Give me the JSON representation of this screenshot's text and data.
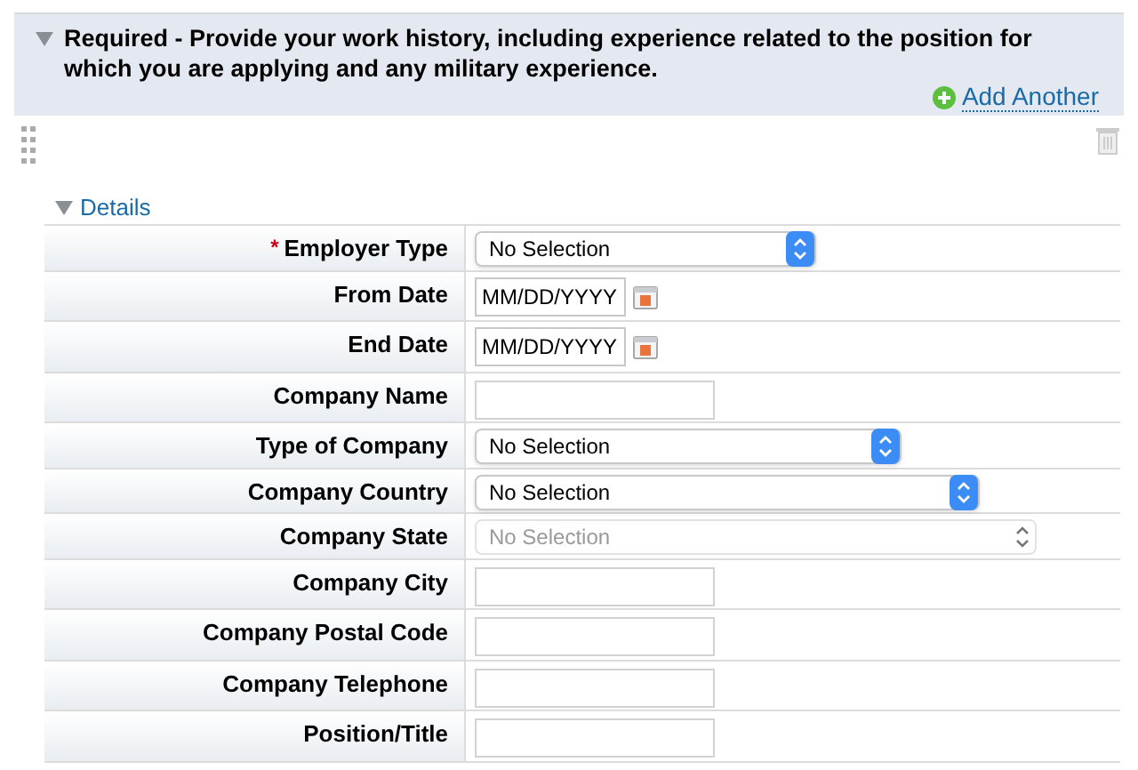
{
  "section": {
    "title": "Required - Provide your work history, including experience related to the position for which you are applying and any military experience.",
    "expanded": true,
    "add_link": "Add Another"
  },
  "details": {
    "title": "Details",
    "expanded": true
  },
  "fields": [
    {
      "label": "Employer Type",
      "required_mark": "*",
      "kind": "select",
      "value": "No Selection",
      "disabled": false
    },
    {
      "label": "From Date",
      "kind": "date",
      "placeholder": "MM/DD/YYYY"
    },
    {
      "label": "End Date",
      "kind": "date",
      "placeholder": "MM/DD/YYYY"
    },
    {
      "label": "Company Name",
      "kind": "text"
    },
    {
      "label": "Type of Company",
      "kind": "select",
      "value": "No Selection",
      "disabled": false
    },
    {
      "label": "Company Country",
      "kind": "select",
      "value": "No Selection",
      "disabled": false
    },
    {
      "label": "Company State",
      "kind": "select",
      "value": "No Selection",
      "disabled": true
    },
    {
      "label": "Company City",
      "kind": "text"
    },
    {
      "label": "Company Postal Code",
      "kind": "text"
    },
    {
      "label": "Company Telephone",
      "kind": "text"
    },
    {
      "label": "Position/Title",
      "kind": "text"
    }
  ]
}
